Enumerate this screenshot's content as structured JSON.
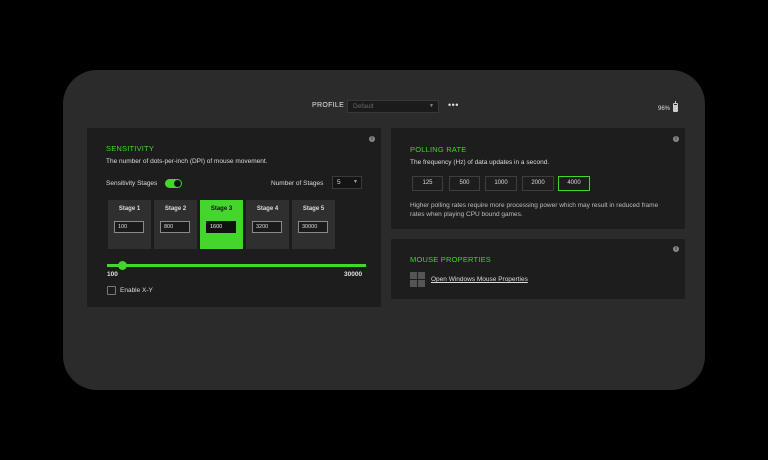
{
  "header": {
    "profile_label": "PROFILE",
    "profile_value": "Default",
    "more_icon": "more-horizontal-icon",
    "battery": "96%"
  },
  "sensitivity": {
    "title": "SENSITIVITY",
    "description": "The number of dots-per-inch (DPI) of mouse movement.",
    "stages_toggle_label": "Sensitivity Stages",
    "stages_toggle_on": true,
    "num_stages_label": "Number of Stages",
    "num_stages_value": "5",
    "stages": [
      {
        "label": "Stage 1",
        "value": "100",
        "active": false
      },
      {
        "label": "Stage 2",
        "value": "800",
        "active": false
      },
      {
        "label": "Stage 3",
        "value": "1600",
        "active": true
      },
      {
        "label": "Stage 4",
        "value": "3200",
        "active": false
      },
      {
        "label": "Stage 5",
        "value": "30000",
        "active": false
      }
    ],
    "slider": {
      "min_label": "100",
      "max_label": "30000",
      "min": 100,
      "max": 30000
    },
    "enable_xy_label": "Enable X-Y",
    "enable_xy_checked": false
  },
  "polling": {
    "title": "POLLING RATE",
    "description": "The frequency (Hz) of data updates in a second.",
    "rates": [
      {
        "label": "125",
        "active": false
      },
      {
        "label": "500",
        "active": false
      },
      {
        "label": "1000",
        "active": false
      },
      {
        "label": "2000",
        "active": false
      },
      {
        "label": "4000",
        "active": true
      }
    ],
    "note": "Higher polling rates require more processing power which may result in reduced frame rates when playing CPU bound games."
  },
  "mouse_properties": {
    "title": "MOUSE PROPERTIES",
    "link": "Open Windows Mouse Properties",
    "icon": "windows-logo-icon"
  },
  "colors": {
    "accent": "#44d62c",
    "panel": "#1d1d1d",
    "window": "#2b2b2b"
  }
}
